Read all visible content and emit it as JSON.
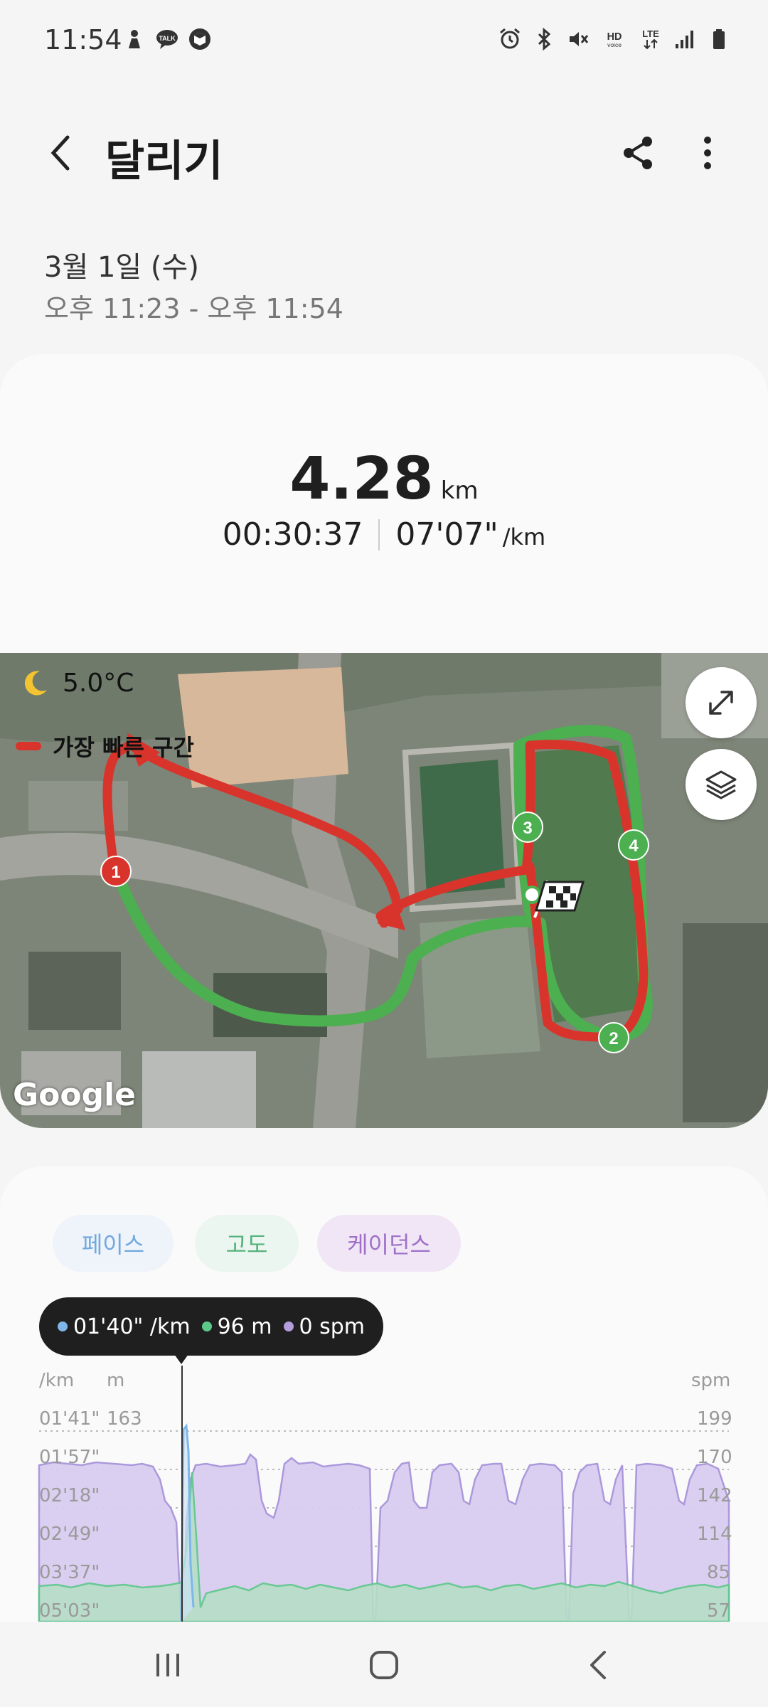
{
  "status_bar": {
    "time": "11:54",
    "left_icons": [
      "person-icon",
      "talk-icon",
      "cube-icon"
    ],
    "right_icons": [
      "alarm-icon",
      "bluetooth-icon",
      "mute-icon",
      "hd-voice-icon",
      "lte-icon",
      "signal-icon",
      "battery-icon"
    ],
    "talk_label": "TALK",
    "hd_label": "HD",
    "voice_label": "voice",
    "lte_label": "LTE"
  },
  "header": {
    "title": "달리기"
  },
  "session": {
    "date": "3월 1일 (수)",
    "time_range": "오후 11:23 - 오후 11:54"
  },
  "summary": {
    "distance": "4.28",
    "distance_unit": "km",
    "duration": "00:30:37",
    "pace": "07'07\"",
    "pace_unit": "/km"
  },
  "map": {
    "temperature": "5.0°C",
    "legend_label": "가장 빠른 구간",
    "provider": "Google",
    "lap_markers": [
      "1",
      "2",
      "3",
      "4"
    ],
    "colors": {
      "route": "#4caf50",
      "fastest": "#d9342b"
    }
  },
  "chart": {
    "tabs": [
      "페이스",
      "고도",
      "케이던스"
    ],
    "tooltip": {
      "pace": "01'40\" /km",
      "altitude": "96 m",
      "cadence": "0 spm"
    },
    "axis_units": {
      "left1": "/km",
      "left2": "m",
      "right": "spm"
    },
    "pace_ticks": [
      "01'41\"",
      "01'57\"",
      "02'18\"",
      "02'49\"",
      "03'37\"",
      "05'03\""
    ],
    "altitude_ticks": [
      "163"
    ],
    "cadence_ticks": [
      "199",
      "170",
      "142",
      "114",
      "85",
      "57"
    ],
    "colors": {
      "pace": "#7fb6ea",
      "altitude": "#5cc98b",
      "cadence": "#b39ddb"
    }
  },
  "nav": {
    "recents": "recents-icon",
    "home": "home-icon",
    "back": "back-icon"
  }
}
